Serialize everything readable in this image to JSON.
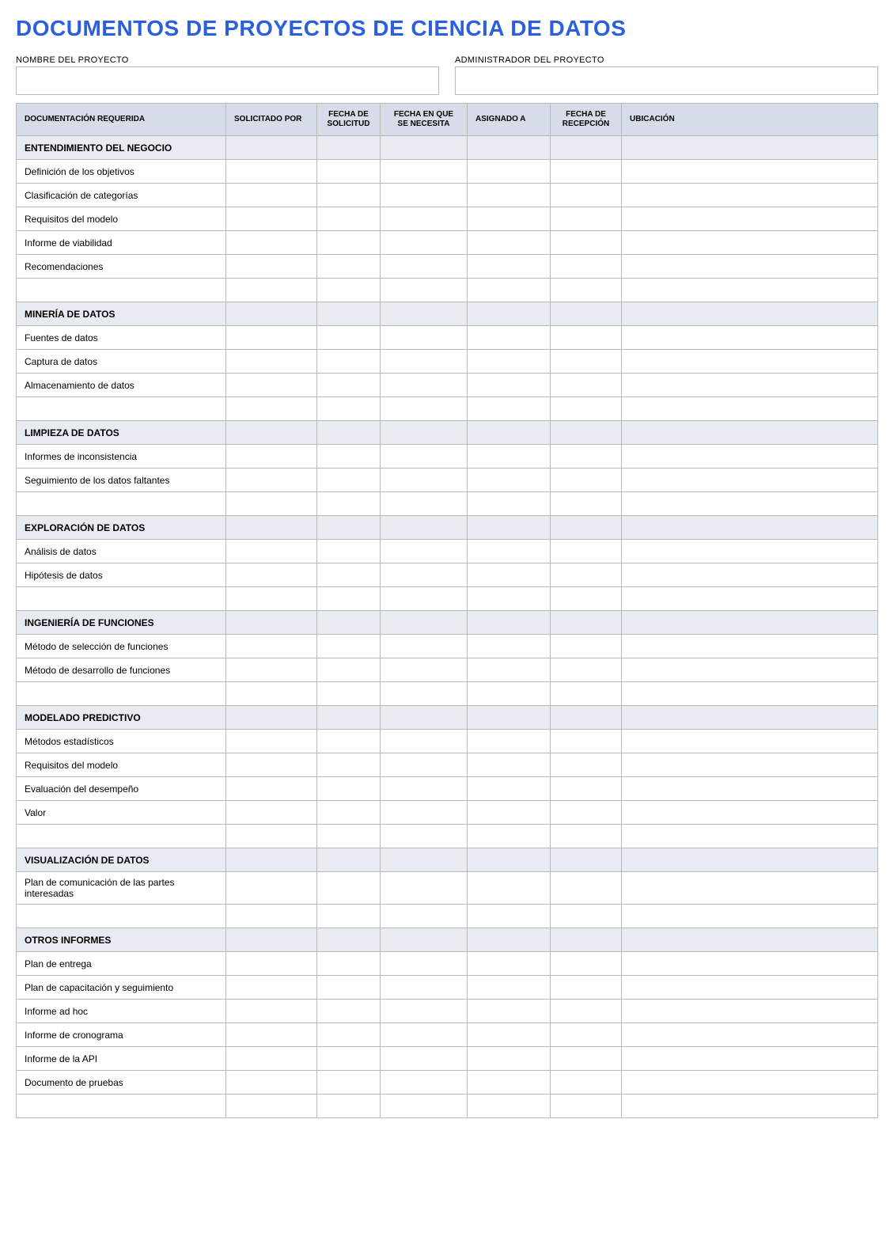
{
  "title": "DOCUMENTOS DE PROYECTOS DE CIENCIA DE DATOS",
  "meta": {
    "project_name_label": "NOMBRE DEL PROYECTO",
    "project_name_value": "",
    "project_manager_label": "ADMINISTRADOR DEL PROYECTO",
    "project_manager_value": ""
  },
  "columns": [
    "DOCUMENTACIÓN REQUERIDA",
    "SOLICITADO POR",
    "FECHA DE SOLICITUD",
    "FECHA EN QUE SE NECESITA",
    "ASIGNADO A",
    "FECHA DE RECEPCIÓN",
    "UBICACIÓN"
  ],
  "sections": [
    {
      "name": "ENTENDIMIENTO DEL NEGOCIO",
      "items": [
        "Definición de los objetivos",
        "Clasificación de categorías",
        "Requisitos del modelo",
        "Informe de viabilidad",
        "Recomendaciones",
        ""
      ]
    },
    {
      "name": "MINERÍA DE DATOS",
      "items": [
        "Fuentes de datos",
        "Captura de datos",
        "Almacenamiento de datos",
        ""
      ]
    },
    {
      "name": "LIMPIEZA DE DATOS",
      "items": [
        "Informes de inconsistencia",
        "Seguimiento de los datos faltantes",
        ""
      ]
    },
    {
      "name": "EXPLORACIÓN DE DATOS",
      "items": [
        "Análisis de datos",
        "Hipótesis de datos",
        ""
      ]
    },
    {
      "name": "INGENIERÍA DE FUNCIONES",
      "items": [
        "Método de selección de funciones",
        "Método de desarrollo de funciones",
        ""
      ]
    },
    {
      "name": "MODELADO PREDICTIVO",
      "items": [
        "Métodos estadísticos",
        "Requisitos del modelo",
        "Evaluación del desempeño",
        "Valor",
        ""
      ]
    },
    {
      "name": "VISUALIZACIÓN DE DATOS",
      "items": [
        "Plan de comunicación de las partes interesadas",
        ""
      ]
    },
    {
      "name": "OTROS INFORMES",
      "items": [
        "Plan de entrega",
        "Plan de capacitación y seguimiento",
        "Informe ad hoc",
        "Informe de cronograma",
        "Informe de la API",
        "Documento de pruebas",
        ""
      ]
    }
  ]
}
